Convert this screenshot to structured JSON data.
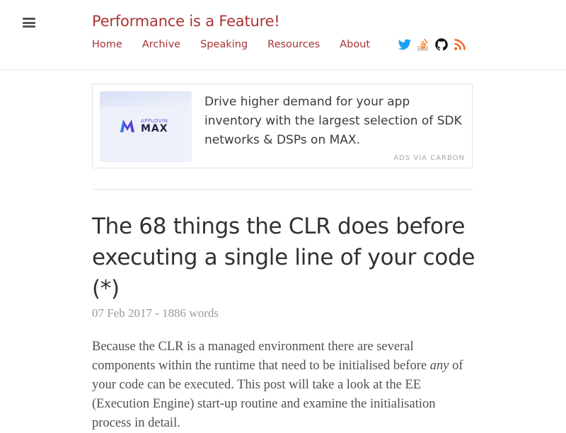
{
  "header": {
    "site_title": "Performance is a Feature!",
    "nav": [
      "Home",
      "Archive",
      "Speaking",
      "Resources",
      "About"
    ],
    "social_icons": [
      "twitter-icon",
      "stackoverflow-icon",
      "github-icon",
      "rss-icon"
    ]
  },
  "ad": {
    "brand_small": "APPLOVIN",
    "brand_big": "MAX",
    "text": "Drive higher demand for your app inventory with the largest selection of SDK networks & DSPs on MAX.",
    "via": "ADS VIA CARBON"
  },
  "post": {
    "title": "The 68 things the CLR does before executing a single line of your code (*)",
    "meta": "07 Feb 2017 - 1886 words",
    "body_before": "Because the CLR is a managed environment there are several components within the runtime that need to be initialised before ",
    "body_em": "any",
    "body_after": " of your code can be executed. This post will take a look at the EE (Execution Engine) start-up routine and examine the initialisation process in detail."
  },
  "colors": {
    "accent": "#a93434",
    "text": "#313131",
    "meta": "#9a9a9a",
    "twitter": "#1da1f2",
    "stackoverflow": "#f48024",
    "rss": "#f26522"
  }
}
